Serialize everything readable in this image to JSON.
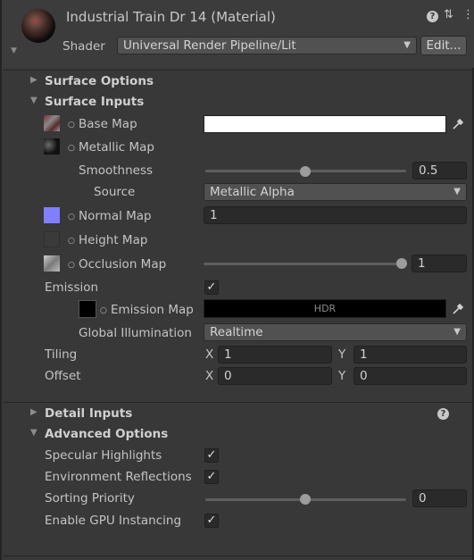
{
  "header": {
    "title": "Industrial Train Dr 14 (Material)",
    "shader_label": "Shader",
    "shader_value": "Universal Render Pipeline/Lit",
    "edit_label": "Edit...",
    "help_glyph": "?",
    "settings_glyph": "⇅",
    "menu_glyph": "⋮"
  },
  "sections": {
    "surface_options": "Surface Options",
    "surface_inputs": "Surface Inputs",
    "detail_inputs": "Detail Inputs",
    "advanced_options": "Advanced Options"
  },
  "surface_inputs": {
    "base_map": "Base Map",
    "metallic_map": "Metallic Map",
    "smoothness_label": "Smoothness",
    "smoothness_value": "0.5",
    "smoothness_level": 0.5,
    "source_label": "Source",
    "source_value": "Metallic Alpha",
    "normal_map": "Normal Map",
    "normal_value": "1",
    "height_map": "Height Map",
    "occlusion_map": "Occlusion Map",
    "occlusion_value": "1",
    "occlusion_level": 1.0,
    "emission_label": "Emission",
    "emission_map": "Emission Map",
    "emission_hdr": "HDR",
    "gi_label": "Global Illumination",
    "gi_value": "Realtime",
    "tiling_label": "Tiling",
    "tiling_x": "1",
    "tiling_y": "1",
    "offset_label": "Offset",
    "offset_x": "0",
    "offset_y": "0",
    "x_label": "X",
    "y_label": "Y"
  },
  "advanced": {
    "specular_highlights": "Specular Highlights",
    "environment_reflections": "Environment Reflections",
    "sorting_priority_label": "Sorting Priority",
    "sorting_priority_value": "0",
    "sorting_priority_level": 0.5,
    "gpu_instancing": "Enable GPU Instancing"
  },
  "colors": {
    "base_map_color": "#ffffff",
    "normal_map_color": "#8080ff",
    "emission_color": "#000000"
  },
  "icons": {
    "checkmark": "✓",
    "eyedropper": "eyedropper-icon",
    "foldout_open": "▼",
    "foldout_closed": "▶"
  }
}
